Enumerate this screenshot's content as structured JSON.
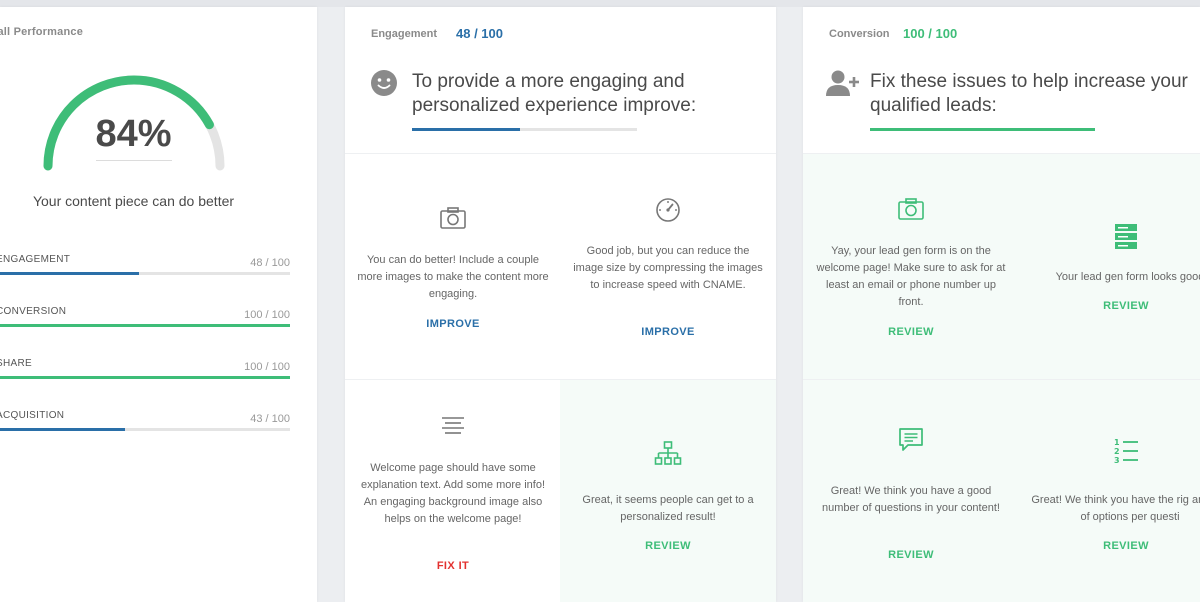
{
  "colors": {
    "green": "#3ebd78",
    "blue": "#2a6fa8",
    "red": "#e3312f",
    "track": "#e4e4e4"
  },
  "overall": {
    "title": "rall Performance",
    "percent": 84,
    "percent_label": "84%",
    "message": "Your content piece can do better",
    "metrics": [
      {
        "name": "ENGAGEMENT",
        "score_label": "48 / 100",
        "value": 48,
        "color": "blue"
      },
      {
        "name": "CONVERSION",
        "score_label": "100 / 100",
        "value": 100,
        "color": "green"
      },
      {
        "name": "SHARE",
        "score_label": "100 / 100",
        "value": 100,
        "color": "green"
      },
      {
        "name": "ACQUISITION",
        "score_label": "43 / 100",
        "value": 43,
        "color": "blue"
      }
    ]
  },
  "engagement": {
    "category": "Engagement",
    "score_label": "48 / 100",
    "value": 48,
    "head_icon": "smiley-icon",
    "headline": "To provide a more engaging and personalized experience improve:",
    "cells": [
      {
        "icon": "camera-icon",
        "text": "You can do better! Include a couple more images to make the content more engaging.",
        "action": "IMPROVE",
        "action_color": "blue"
      },
      {
        "icon": "speedometer-icon",
        "text": "Good job, but you can reduce the image size by compressing the images to increase speed with CNAME.",
        "action": "IMPROVE",
        "action_color": "blue"
      },
      {
        "icon": "text-align-icon",
        "text": "Welcome page should have some explanation text. Add some more info! An engaging background image also helps on the welcome page!",
        "action": "FIX IT",
        "action_color": "red"
      },
      {
        "icon": "sitemap-icon",
        "text": "Great, it seems people can get to a personalized result!",
        "action": "REVIEW",
        "action_color": "green"
      }
    ]
  },
  "conversion": {
    "category": "Conversion",
    "score_label": "100 / 100",
    "value": 100,
    "head_icon": "add-user-icon",
    "headline": "Fix these issues to help increase your qualified leads:",
    "cells": [
      {
        "icon": "camera-icon",
        "text": "Yay, your lead gen form is on the welcome page! Make sure to ask for at least an email or phone number up front.",
        "action": "REVIEW",
        "action_color": "green"
      },
      {
        "icon": "server-icon",
        "text": "Your lead gen form looks good",
        "action": "REVIEW",
        "action_color": "green"
      },
      {
        "icon": "message-icon",
        "text": "Great! We think you have a good number of questions in your content!",
        "action": "REVIEW",
        "action_color": "green"
      },
      {
        "icon": "numbered-list-icon",
        "text": "Great! We think you have the rig amount of options per questi",
        "action": "REVIEW",
        "action_color": "green"
      }
    ]
  }
}
